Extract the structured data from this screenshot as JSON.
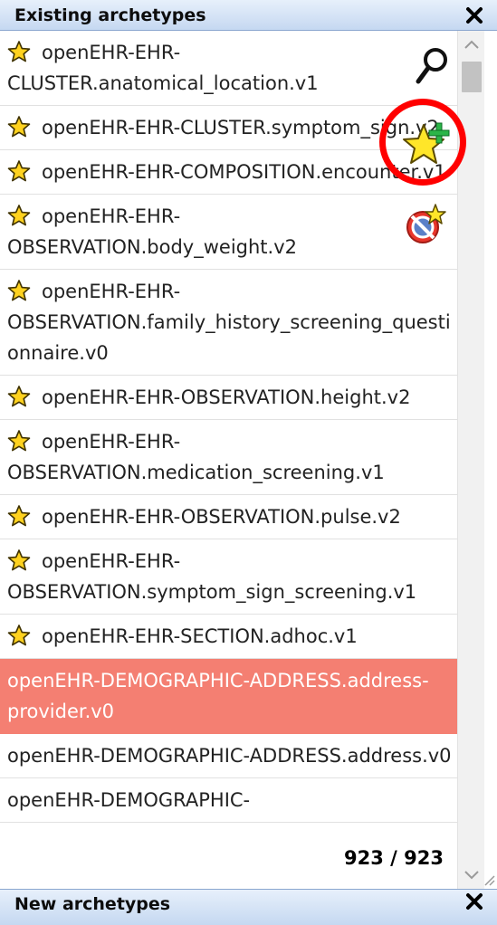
{
  "panel": {
    "title": "Existing archetypes",
    "close_label": "✕",
    "count": "923 / 923"
  },
  "archetypes": [
    {
      "label": "openEHR-EHR-CLUSTER.anatomical_location.v1",
      "favorite": true,
      "selected": false
    },
    {
      "label": "openEHR-EHR-CLUSTER.symptom_sign.v2",
      "favorite": true,
      "selected": false
    },
    {
      "label": "openEHR-EHR-COMPOSITION.encounter.v1",
      "favorite": true,
      "selected": false
    },
    {
      "label": "openEHR-EHR-OBSERVATION.body_weight.v2",
      "favorite": true,
      "selected": false
    },
    {
      "label": "openEHR-EHR-OBSERVATION.family_history_screening_questionnaire.v0",
      "favorite": true,
      "selected": false
    },
    {
      "label": "openEHR-EHR-OBSERVATION.height.v2",
      "favorite": true,
      "selected": false
    },
    {
      "label": "openEHR-EHR-OBSERVATION.medication_screening.v1",
      "favorite": true,
      "selected": false
    },
    {
      "label": "openEHR-EHR-OBSERVATION.pulse.v2",
      "favorite": true,
      "selected": false
    },
    {
      "label": "openEHR-EHR-OBSERVATION.symptom_sign_screening.v1",
      "favorite": true,
      "selected": false
    },
    {
      "label": "openEHR-EHR-SECTION.adhoc.v1",
      "favorite": true,
      "selected": false
    },
    {
      "label": "openEHR-DEMOGRAPHIC-ADDRESS.address-provider.v0",
      "favorite": false,
      "selected": true
    },
    {
      "label": "openEHR-DEMOGRAPHIC-ADDRESS.address.v0",
      "favorite": false,
      "selected": false
    },
    {
      "label": "openEHR-DEMOGRAPHIC-",
      "favorite": false,
      "selected": false
    }
  ],
  "tools": {
    "search_icon": "magnifier-icon",
    "add_favorite_icon": "star-plus-icon",
    "remove_favorite_icon": "star-remove-icon"
  },
  "next_panel": {
    "title": "New archetypes"
  },
  "colors": {
    "selected_row": "#f47f72",
    "titlebar": "#c5d8f1",
    "highlight": "#ff0000"
  }
}
